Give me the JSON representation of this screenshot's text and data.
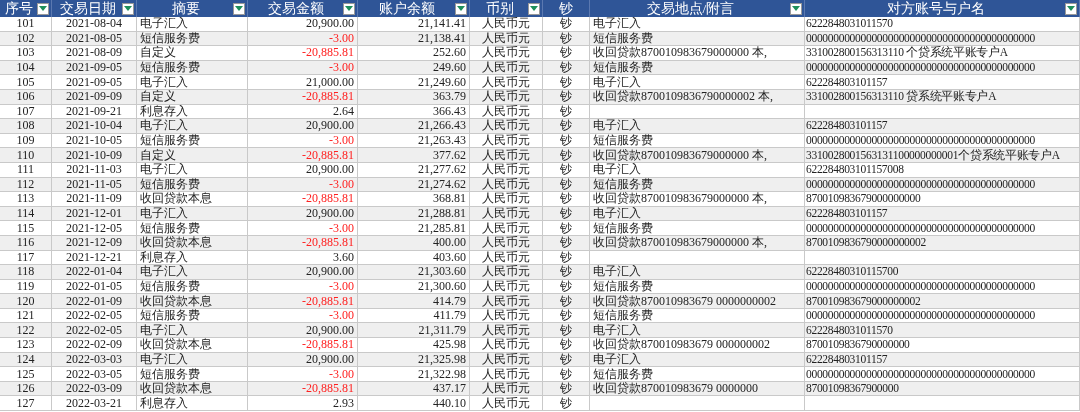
{
  "table": {
    "columns": [
      {
        "label": "序号",
        "filter": true
      },
      {
        "label": "交易日期",
        "filter": true
      },
      {
        "label": "摘要",
        "filter": true
      },
      {
        "label": "交易金额",
        "filter": true
      },
      {
        "label": "账户余额",
        "filter": true
      },
      {
        "label": "币别",
        "filter": true
      },
      {
        "label": "钞",
        "filter": false
      },
      {
        "label": "交易地点/附言",
        "filter": true
      },
      {
        "label": "对方账号与户名",
        "filter": true
      }
    ],
    "rows": [
      {
        "cells": [
          "101",
          "2021-08-04",
          "电子汇入",
          "20,900.00",
          "21,141.41",
          "人民币元",
          "钞",
          "电子汇入",
          "6222848031011570"
        ],
        "negative": false
      },
      {
        "cells": [
          "102",
          "2021-08-05",
          "短信服务费",
          "-3.00",
          "21,138.41",
          "人民币元",
          "钞",
          "短信服务费",
          "000000000000000000000000000000000000000000"
        ],
        "negative": true
      },
      {
        "cells": [
          "103",
          "2021-08-09",
          "自定义",
          "-20,885.81",
          "252.60",
          "人民币元",
          "钞",
          "收回贷款870010983679000000 本,",
          "331002800156313110 个贷系统平账专户A"
        ],
        "negative": true
      },
      {
        "cells": [
          "104",
          "2021-09-05",
          "短信服务费",
          "-3.00",
          "249.60",
          "人民币元",
          "钞",
          "短信服务费",
          "000000000000000000000000000000000000000000"
        ],
        "negative": true
      },
      {
        "cells": [
          "105",
          "2021-09-05",
          "电子汇入",
          "21,000.00",
          "21,249.60",
          "人民币元",
          "钞",
          "电子汇入",
          "622284803101157"
        ],
        "negative": false
      },
      {
        "cells": [
          "106",
          "2021-09-09",
          "自定义",
          "-20,885.81",
          "363.79",
          "人民币元",
          "钞",
          "收回贷款8700109836790000002 本,",
          "331002800156313110 贷系统平账专户A"
        ],
        "negative": true
      },
      {
        "cells": [
          "107",
          "2021-09-21",
          "利息存入",
          "2.64",
          "366.43",
          "人民币元",
          "钞",
          "",
          ""
        ],
        "negative": false
      },
      {
        "cells": [
          "108",
          "2021-10-04",
          "电子汇入",
          "20,900.00",
          "21,266.43",
          "人民币元",
          "钞",
          "电子汇入",
          "622284803101157"
        ],
        "negative": false
      },
      {
        "cells": [
          "109",
          "2021-10-05",
          "短信服务费",
          "-3.00",
          "21,263.43",
          "人民币元",
          "钞",
          "短信服务费",
          "000000000000000000000000000000000000000000"
        ],
        "negative": true
      },
      {
        "cells": [
          "110",
          "2021-10-09",
          "自定义",
          "-20,885.81",
          "377.62",
          "人民币元",
          "钞",
          "收回贷款870010983679000000 本,",
          "3310028001563131100000000001个贷系统平账专户A"
        ],
        "negative": true
      },
      {
        "cells": [
          "111",
          "2021-11-03",
          "电子汇入",
          "20,900.00",
          "21,277.62",
          "人民币元",
          "钞",
          "电子汇入",
          "622284803101157008"
        ],
        "negative": false
      },
      {
        "cells": [
          "112",
          "2021-11-05",
          "短信服务费",
          "-3.00",
          "21,274.62",
          "人民币元",
          "钞",
          "短信服务费",
          "000000000000000000000000000000000000000000"
        ],
        "negative": true
      },
      {
        "cells": [
          "113",
          "2021-11-09",
          "收回贷款本息",
          "-20,885.81",
          "368.81",
          "人民币元",
          "钞",
          "收回贷款870010983679000000 本,",
          "870010983679000000000"
        ],
        "negative": true
      },
      {
        "cells": [
          "114",
          "2021-12-01",
          "电子汇入",
          "20,900.00",
          "21,288.81",
          "人民币元",
          "钞",
          "电子汇入",
          "622284803101157"
        ],
        "negative": false
      },
      {
        "cells": [
          "115",
          "2021-12-05",
          "短信服务费",
          "-3.00",
          "21,285.81",
          "人民币元",
          "钞",
          "短信服务费",
          "000000000000000000000000000000000000000000"
        ],
        "negative": true
      },
      {
        "cells": [
          "116",
          "2021-12-09",
          "收回贷款本息",
          "-20,885.81",
          "400.00",
          "人民币元",
          "钞",
          "收回贷款870010983679000000 本,",
          "8700109836790000000002"
        ],
        "negative": true
      },
      {
        "cells": [
          "117",
          "2021-12-21",
          "利息存入",
          "3.60",
          "403.60",
          "人民币元",
          "钞",
          "",
          ""
        ],
        "negative": false
      },
      {
        "cells": [
          "118",
          "2022-01-04",
          "电子汇入",
          "20,900.00",
          "21,303.60",
          "人民币元",
          "钞",
          "电子汇入",
          "62228480310115700"
        ],
        "negative": false
      },
      {
        "cells": [
          "119",
          "2022-01-05",
          "短信服务费",
          "-3.00",
          "21,300.60",
          "人民币元",
          "钞",
          "短信服务费",
          "000000000000000000000000000000000000000000"
        ],
        "negative": true
      },
      {
        "cells": [
          "120",
          "2022-01-09",
          "收回贷款本息",
          "-20,885.81",
          "414.79",
          "人民币元",
          "钞",
          "收回贷款870010983679 0000000002",
          "870010983679000000002"
        ],
        "negative": true
      },
      {
        "cells": [
          "121",
          "2022-02-05",
          "短信服务费",
          "-3.00",
          "411.79",
          "人民币元",
          "钞",
          "短信服务费",
          "000000000000000000000000000000000000000000"
        ],
        "negative": true
      },
      {
        "cells": [
          "122",
          "2022-02-05",
          "电子汇入",
          "20,900.00",
          "21,311.79",
          "人民币元",
          "钞",
          "电子汇入",
          "6222848031011570"
        ],
        "negative": false
      },
      {
        "cells": [
          "123",
          "2022-02-09",
          "收回贷款本息",
          "-20,885.81",
          "425.98",
          "人民币元",
          "钞",
          "收回贷款870010983679 000000002",
          "8700109836790000000"
        ],
        "negative": true
      },
      {
        "cells": [
          "124",
          "2022-03-03",
          "电子汇入",
          "20,900.00",
          "21,325.98",
          "人民币元",
          "钞",
          "电子汇入",
          "622284803101157"
        ],
        "negative": false
      },
      {
        "cells": [
          "125",
          "2022-03-05",
          "短信服务费",
          "-3.00",
          "21,322.98",
          "人民币元",
          "钞",
          "短信服务费",
          "000000000000000000000000000000000000000000"
        ],
        "negative": true
      },
      {
        "cells": [
          "126",
          "2022-03-09",
          "收回贷款本息",
          "-20,885.81",
          "437.17",
          "人民币元",
          "钞",
          "收回贷款870010983679 0000000",
          "87001098367900000"
        ],
        "negative": true
      },
      {
        "cells": [
          "127",
          "2022-03-21",
          "利息存入",
          "2.93",
          "440.10",
          "人民币元",
          "钞",
          "",
          ""
        ],
        "negative": false
      }
    ]
  }
}
